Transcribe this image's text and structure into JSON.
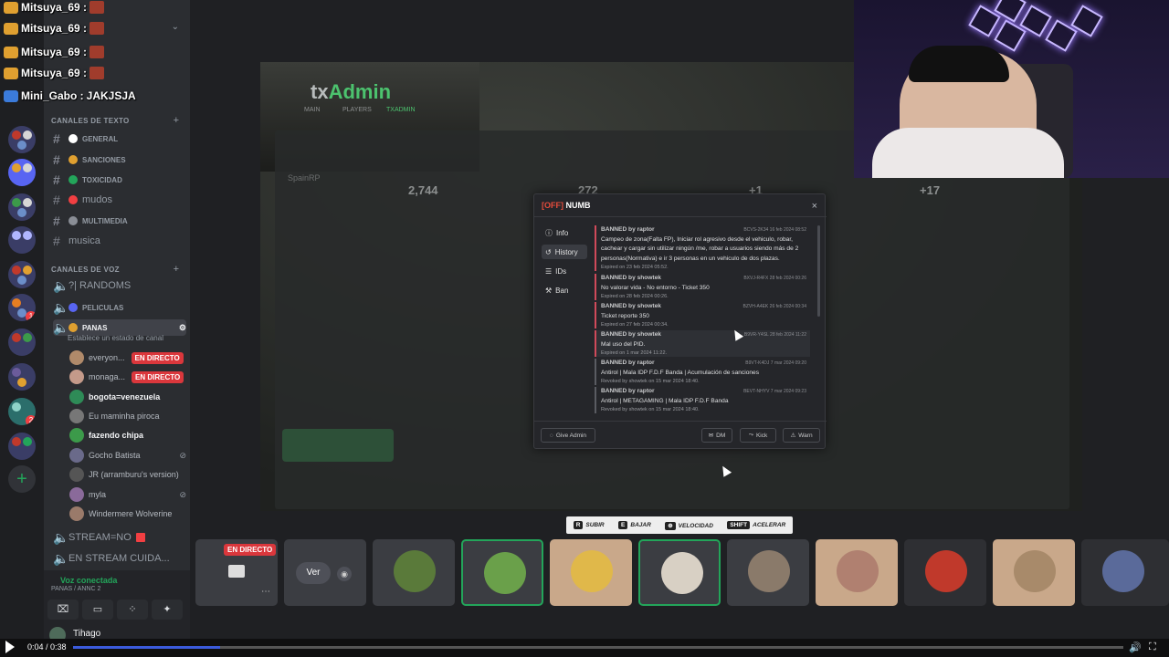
{
  "chat": [
    {
      "user": "Mitsuya_69 :"
    },
    {
      "user": "Mitsuya_69 :"
    },
    {
      "user": "Mitsuya_69 :"
    },
    {
      "user": "Mitsuya_69 :"
    },
    {
      "user": "Mini_Gabo :",
      "text": "JAKJSJA"
    }
  ],
  "channels": {
    "text_category": "CANALES DE TEXTO",
    "text": [
      "GENERAL",
      "SANCIONES",
      "TOXICIDAD",
      "mudos",
      "MULTIMEDIA",
      "musica"
    ],
    "voice_category": "CANALES DE VOZ",
    "voice": [
      "?| RANDOMS",
      "PELICULAS",
      "PANAS"
    ],
    "panas_status": "Establece un estado de canal",
    "users": [
      {
        "name": "everyon...",
        "badge": "EN DIRECTO"
      },
      {
        "name": "monaga...",
        "badge": "EN DIRECTO"
      },
      {
        "name": "bogota=venezuela"
      },
      {
        "name": "Eu maminha piroca"
      },
      {
        "name": "fazendo chipa"
      },
      {
        "name": "Gocho Batista"
      },
      {
        "name": "JR (arramburu's version)"
      },
      {
        "name": "myla"
      },
      {
        "name": "Windermere Wolverine"
      }
    ],
    "stream_no": "STREAM=NO",
    "stream_cuida": "EN STREAM CUIDA..."
  },
  "voicebar": {
    "status": "Voz conectada",
    "sub": "PANAS / ANNC 2",
    "user": "Tihago"
  },
  "modal": {
    "off": "[OFF]",
    "title": "NUMB",
    "tabs": [
      "Info",
      "History",
      "IDs",
      "Ban"
    ],
    "bans": [
      {
        "by": "BANNED by raptor",
        "id": "BCVS-2K34",
        "date": "16 feb 2024 08:52",
        "reason": "Campeo de zona(Falta FP), Iniciar rol agresivo desde el vehiculo, robar, cachear y cargar sin utilizar ningún /me, robar a usuarios siendo más de 2 personas(Normativa) e ir 3 personas en un vehiculo de dos plazas.",
        "exp": "Expired on 23 feb 2024 05:52."
      },
      {
        "by": "BANNED by showtek",
        "id": "BXVJ-R4FX",
        "date": "28 feb 2024 00:26",
        "reason": "No valorar vida - No entorno - Ticket 350",
        "exp": "Expired on 28 feb 2024 00:26."
      },
      {
        "by": "BANNED by showtek",
        "id": "BZVH-A4EK",
        "date": "26 feb 2024 00:34",
        "reason": "Ticket reporte 350",
        "exp": "Expired on 27 feb 2024 00:34."
      },
      {
        "by": "BANNED by showtek",
        "id": "B9VR-Y4SL",
        "date": "28 feb 2024 11:22",
        "reason": "Mal uso del PID.",
        "exp": "Expired on 1 mar 2024 11:22."
      },
      {
        "by": "BANNED by raptor",
        "id": "B9VT-K4DJ",
        "date": "7 mar 2024 09:20",
        "reason": "Antirol | Mala IDP F.D.F Banda | Acumulación de sanciones",
        "exp": "Revoked by showtek on 15 mar 2024 18:40."
      },
      {
        "by": "BANNED by raptor",
        "id": "BEVT-NHYV",
        "date": "7 mar 2024 09:23",
        "reason": "Antirol | METAGAMING | Mala IDP F.D.F Banda",
        "exp": "Revoked by showtek on 15 mar 2024 18:40."
      }
    ],
    "buttons": {
      "give_admin": "Give Admin",
      "dm": "DM",
      "kick": "Kick",
      "warn": "Warn"
    }
  },
  "txadmin": {
    "logo_a": "tx",
    "logo_b": "Admin",
    "nav": [
      "MAIN",
      "PLAYERS",
      "TXADMIN"
    ],
    "server": "SpainRP",
    "stat1": "2,744",
    "stat2": "272",
    "stat3": "+1",
    "stat4": "+17"
  },
  "controls": [
    {
      "key": "R",
      "label": "SUBIR"
    },
    {
      "key": "E",
      "label": "BAJAR"
    },
    {
      "key": "⊕",
      "label": "VELOCIDAD"
    },
    {
      "key": "SHIFT",
      "label": "ACELERAR"
    }
  ],
  "stream": {
    "live": "EN DIRECTO",
    "ver": "Ver"
  },
  "player": {
    "time": "0:04 / 0:38",
    "progress": 0.14
  }
}
